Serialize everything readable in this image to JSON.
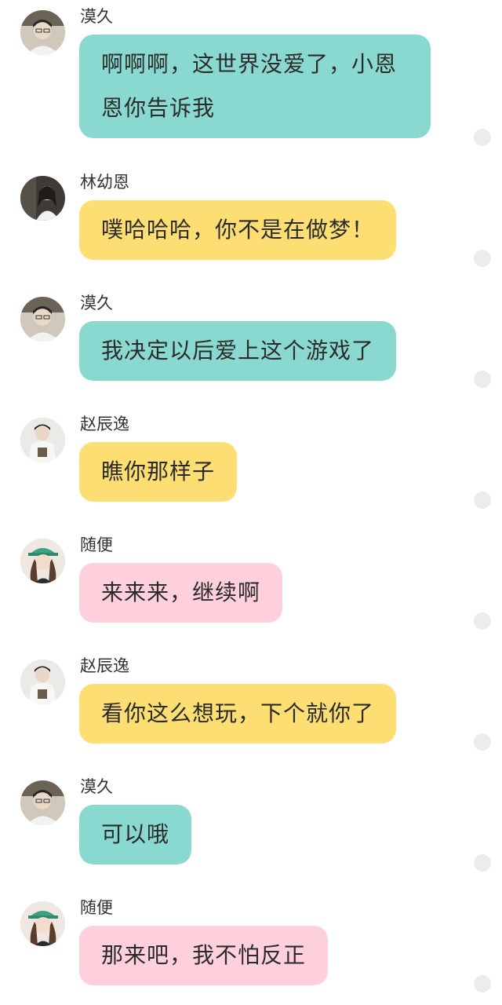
{
  "messages": [
    {
      "name": "漠久",
      "text": "啊啊啊，这世界没爱了，小恩恩你告诉我",
      "color": "#89d9d0",
      "avatar_icon": "avatar-mojiu-icon"
    },
    {
      "name": "林幼恩",
      "text": "噗哈哈哈，你不是在做梦！",
      "color": "#fdde73",
      "avatar_icon": "avatar-linyouen-icon"
    },
    {
      "name": "漠久",
      "text": "我决定以后爱上这个游戏了",
      "color": "#89d9d0",
      "avatar_icon": "avatar-mojiu-icon"
    },
    {
      "name": "赵辰逸",
      "text": "瞧你那样子",
      "color": "#fdde73",
      "avatar_icon": "avatar-zhaochenyi-icon"
    },
    {
      "name": "随便",
      "text": "来来来，继续啊",
      "color": "#fdd0dc",
      "avatar_icon": "avatar-suibian-icon"
    },
    {
      "name": "赵辰逸",
      "text": "看你这么想玩，下个就你了",
      "color": "#fdde73",
      "avatar_icon": "avatar-zhaochenyi-icon"
    },
    {
      "name": "漠久",
      "text": "可以哦",
      "color": "#89d9d0",
      "avatar_icon": "avatar-mojiu-icon"
    },
    {
      "name": "随便",
      "text": "那来吧，我不怕反正",
      "color": "#fdd0dc",
      "avatar_icon": "avatar-suibian-icon"
    }
  ]
}
